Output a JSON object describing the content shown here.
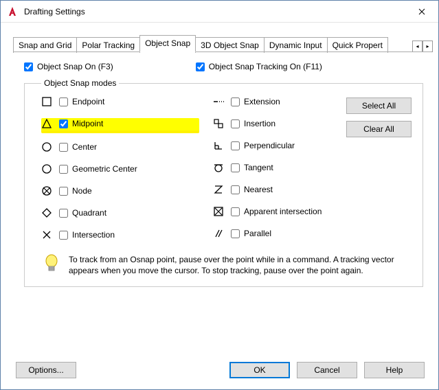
{
  "window": {
    "title": "Drafting Settings"
  },
  "tabs": {
    "items": [
      "Snap and Grid",
      "Polar Tracking",
      "Object Snap",
      "3D Object Snap",
      "Dynamic Input",
      "Quick Propert"
    ],
    "active_index": 2
  },
  "top_checks": {
    "osnap_on": {
      "label": "Object Snap On (F3)",
      "checked": true
    },
    "otrack_on": {
      "label": "Object Snap Tracking On (F11)",
      "checked": true
    }
  },
  "modes_legend": "Object Snap modes",
  "modes": {
    "left": [
      {
        "key": "endpoint",
        "label": "Endpoint",
        "checked": false
      },
      {
        "key": "midpoint",
        "label": "Midpoint",
        "checked": true,
        "highlight": true
      },
      {
        "key": "center",
        "label": "Center",
        "checked": false
      },
      {
        "key": "geocenter",
        "label": "Geometric Center",
        "checked": false
      },
      {
        "key": "node",
        "label": "Node",
        "checked": false
      },
      {
        "key": "quadrant",
        "label": "Quadrant",
        "checked": false
      },
      {
        "key": "intersection",
        "label": "Intersection",
        "checked": false
      }
    ],
    "right": [
      {
        "key": "extension",
        "label": "Extension",
        "checked": false
      },
      {
        "key": "insertion",
        "label": "Insertion",
        "checked": false
      },
      {
        "key": "perpendicular",
        "label": "Perpendicular",
        "checked": false
      },
      {
        "key": "tangent",
        "label": "Tangent",
        "checked": false
      },
      {
        "key": "nearest",
        "label": "Nearest",
        "checked": false
      },
      {
        "key": "appint",
        "label": "Apparent intersection",
        "checked": false
      },
      {
        "key": "parallel",
        "label": "Parallel",
        "checked": false
      }
    ]
  },
  "buttons": {
    "select_all": "Select All",
    "clear_all": "Clear All"
  },
  "hint": "To track from an Osnap point, pause over the point while in a command.  A tracking vector appears when you move the cursor.  To stop tracking, pause over the point again.",
  "footer": {
    "options": "Options...",
    "ok": "OK",
    "cancel": "Cancel",
    "help": "Help"
  }
}
